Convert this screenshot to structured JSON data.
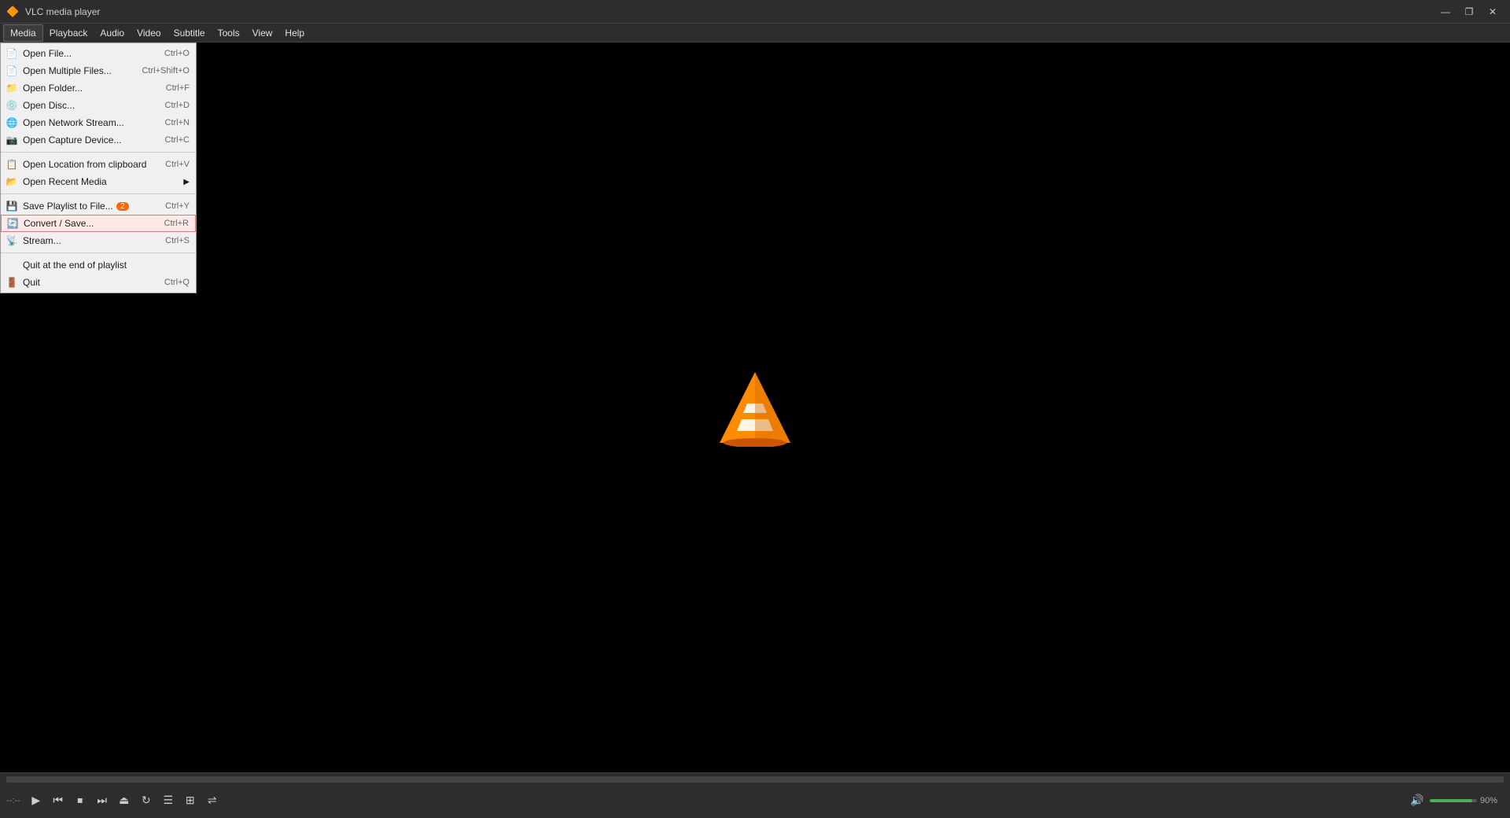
{
  "titleBar": {
    "title": "VLC media player",
    "icon": "🔶",
    "controls": {
      "minimize": "—",
      "maximize": "❐",
      "close": "✕"
    }
  },
  "menuBar": {
    "items": [
      {
        "id": "media",
        "label": "Media",
        "active": true
      },
      {
        "id": "playback",
        "label": "Playback"
      },
      {
        "id": "audio",
        "label": "Audio"
      },
      {
        "id": "video",
        "label": "Video"
      },
      {
        "id": "subtitle",
        "label": "Subtitle"
      },
      {
        "id": "tools",
        "label": "Tools"
      },
      {
        "id": "view",
        "label": "View"
      },
      {
        "id": "help",
        "label": "Help"
      }
    ]
  },
  "mediaMenu": {
    "items": [
      {
        "id": "open-file",
        "label": "Open File...",
        "shortcut": "Ctrl+O",
        "icon": "📄"
      },
      {
        "id": "open-multiple",
        "label": "Open Multiple Files...",
        "shortcut": "Ctrl+Shift+O",
        "icon": "📄"
      },
      {
        "id": "open-folder",
        "label": "Open Folder...",
        "shortcut": "Ctrl+F",
        "icon": "📁"
      },
      {
        "id": "open-disc",
        "label": "Open Disc...",
        "shortcut": "Ctrl+D",
        "icon": "💿"
      },
      {
        "id": "open-network",
        "label": "Open Network Stream...",
        "shortcut": "Ctrl+N",
        "icon": "🌐"
      },
      {
        "id": "open-capture",
        "label": "Open Capture Device...",
        "shortcut": "Ctrl+C",
        "icon": "📷"
      },
      {
        "id": "separator1",
        "type": "separator"
      },
      {
        "id": "open-location",
        "label": "Open Location from clipboard",
        "shortcut": "Ctrl+V",
        "icon": "📋"
      },
      {
        "id": "open-recent",
        "label": "Open Recent Media",
        "hasSubmenu": true,
        "icon": "📂"
      },
      {
        "id": "separator2",
        "type": "separator"
      },
      {
        "id": "save-playlist",
        "label": "Save Playlist to File...",
        "shortcut": "Ctrl+Y",
        "badge": "2",
        "icon": "💾"
      },
      {
        "id": "convert-save",
        "label": "Convert / Save...",
        "shortcut": "Ctrl+R",
        "highlighted": true,
        "icon": "🔄"
      },
      {
        "id": "stream",
        "label": "Stream...",
        "shortcut": "Ctrl+S",
        "icon": "📡"
      },
      {
        "id": "separator3",
        "type": "separator"
      },
      {
        "id": "quit-end",
        "label": "Quit at the end of playlist",
        "icon": ""
      },
      {
        "id": "quit",
        "label": "Quit",
        "shortcut": "Ctrl+Q",
        "icon": "🚪"
      }
    ]
  },
  "controls": {
    "play": "▶",
    "prev": "⏮",
    "stop": "⏹",
    "next": "⏭",
    "frame": "⏏",
    "loop": "🔁",
    "playlist": "≡",
    "ext": "⊞",
    "shuffle": "⇌",
    "volumePercent": "90%",
    "timeLeft": "--:--",
    "timeRight": "--:--"
  }
}
